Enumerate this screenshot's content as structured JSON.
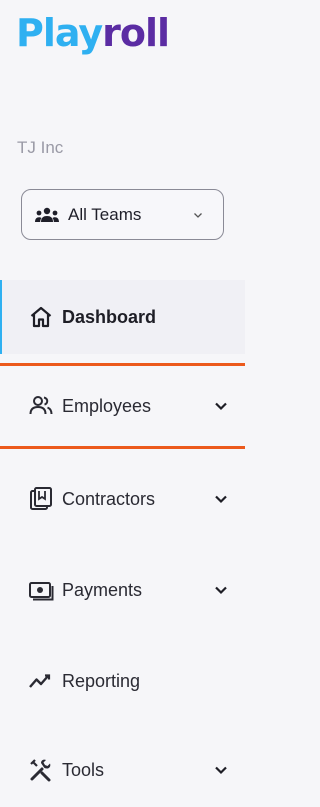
{
  "brand": {
    "part1": "Play",
    "part2": "roll",
    "color1": "#2fb0f1",
    "color2": "#5b2ca3"
  },
  "org": {
    "name": "TJ Inc"
  },
  "team_select": {
    "value": "All Teams",
    "icon": "team-icon"
  },
  "nav": {
    "items": [
      {
        "label": "Dashboard",
        "icon": "house-icon",
        "active": true,
        "expandable": false
      },
      {
        "label": "Employees",
        "icon": "users-icon",
        "active": false,
        "expandable": true,
        "highlighted": true
      },
      {
        "label": "Contractors",
        "icon": "contract-icon",
        "active": false,
        "expandable": true
      },
      {
        "label": "Payments",
        "icon": "payment-icon",
        "active": false,
        "expandable": true
      },
      {
        "label": "Reporting",
        "icon": "trend-icon",
        "active": false,
        "expandable": false
      },
      {
        "label": "Tools",
        "icon": "tools-icon",
        "active": false,
        "expandable": true
      }
    ]
  },
  "colors": {
    "accent": "#2fb0f1",
    "highlight": "#ec5a1c"
  }
}
